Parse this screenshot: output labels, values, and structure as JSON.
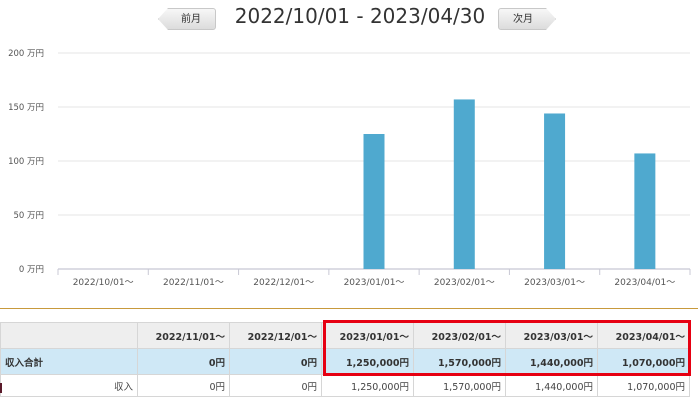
{
  "header": {
    "prev_label": "前月",
    "next_label": "次月",
    "period": "2022/10/01 - 2023/04/30"
  },
  "chart_data": {
    "type": "bar",
    "categories": [
      "2022/10/01～",
      "2022/11/01～",
      "2022/12/01～",
      "2023/01/01～",
      "2023/02/01～",
      "2023/03/01～",
      "2023/04/01～"
    ],
    "values": [
      0,
      0,
      0,
      1250000,
      1570000,
      1440000,
      1070000
    ],
    "y_ticks": [
      {
        "value": 0,
        "label": "0 万円"
      },
      {
        "value": 500000,
        "label": "50 万円"
      },
      {
        "value": 1000000,
        "label": "100 万円"
      },
      {
        "value": 1500000,
        "label": "150 万円"
      },
      {
        "value": 2000000,
        "label": "200 万円"
      }
    ],
    "ylim": [
      0,
      2000000
    ],
    "bar_color": "#4fa9cf",
    "grid": true
  },
  "table": {
    "headers": [
      "",
      "2022/11/01～",
      "2022/12/01～",
      "2023/01/01～",
      "2023/02/01～",
      "2023/03/01～",
      "2023/04/01～"
    ],
    "total_row": {
      "label": "収入合計",
      "values": [
        "0円",
        "0円",
        "1,250,000円",
        "1,570,000円",
        "1,440,000円",
        "1,070,000円"
      ]
    },
    "income_row": {
      "label": "収入",
      "values": [
        "0円",
        "0円",
        "1,250,000円",
        "1,570,000円",
        "1,440,000円",
        "1,070,000円"
      ]
    }
  },
  "colors": {
    "highlight": "#e60012",
    "total_row_bg": "#cfe8f6",
    "separator": "#c89a3c"
  }
}
